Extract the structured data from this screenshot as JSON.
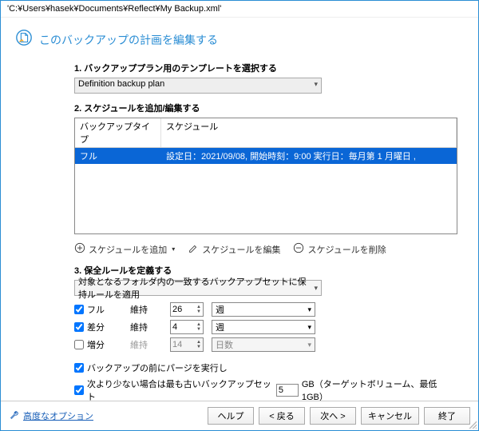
{
  "title": "'C:¥Users¥hasek¥Documents¥Reflect¥My Backup.xml'",
  "header": {
    "title": "このバックアップの計画を編集する"
  },
  "s1": {
    "label": "1. バックアッププラン用のテンプレートを選択する",
    "combo": "Definition backup plan"
  },
  "s2": {
    "label": "2. スケジュールを追加/編集する",
    "cols": {
      "a": "バックアップタイプ",
      "b": "スケジュール"
    },
    "row": {
      "a": "フル",
      "b": "設定日：2021/09/08, 開始時刻：9:00  実行日：毎月第 1 月曜日 ,"
    },
    "add": "スケジュールを追加",
    "edit": "スケジュールを編集",
    "del": "スケジュールを削除"
  },
  "s3": {
    "label": "3. 保全ルールを定義する",
    "combo": "対象となるフォルダ内の一致するバックアップセットに保持ルールを適用",
    "rows": {
      "full": {
        "name": "フル",
        "keep": "維持",
        "val": "26",
        "unit": "週"
      },
      "diff": {
        "name": "差分",
        "keep": "維持",
        "val": "4",
        "unit": "週"
      },
      "inc": {
        "name": "増分",
        "keep": "維持",
        "val": "14",
        "unit": "日数"
      }
    },
    "purge": "バックアップの前にパージを実行し",
    "lowspace_a": "次より少ない場合は最も古いバックアップセット",
    "lowspace_val": "5",
    "lowspace_b": "GB（ターゲットボリューム、最低1GB）"
  },
  "adv": "高度なオプション",
  "footer": {
    "help": "ヘルプ",
    "back": "< 戻る",
    "next": "次へ >",
    "cancel": "キャンセル",
    "finish": "終了"
  }
}
